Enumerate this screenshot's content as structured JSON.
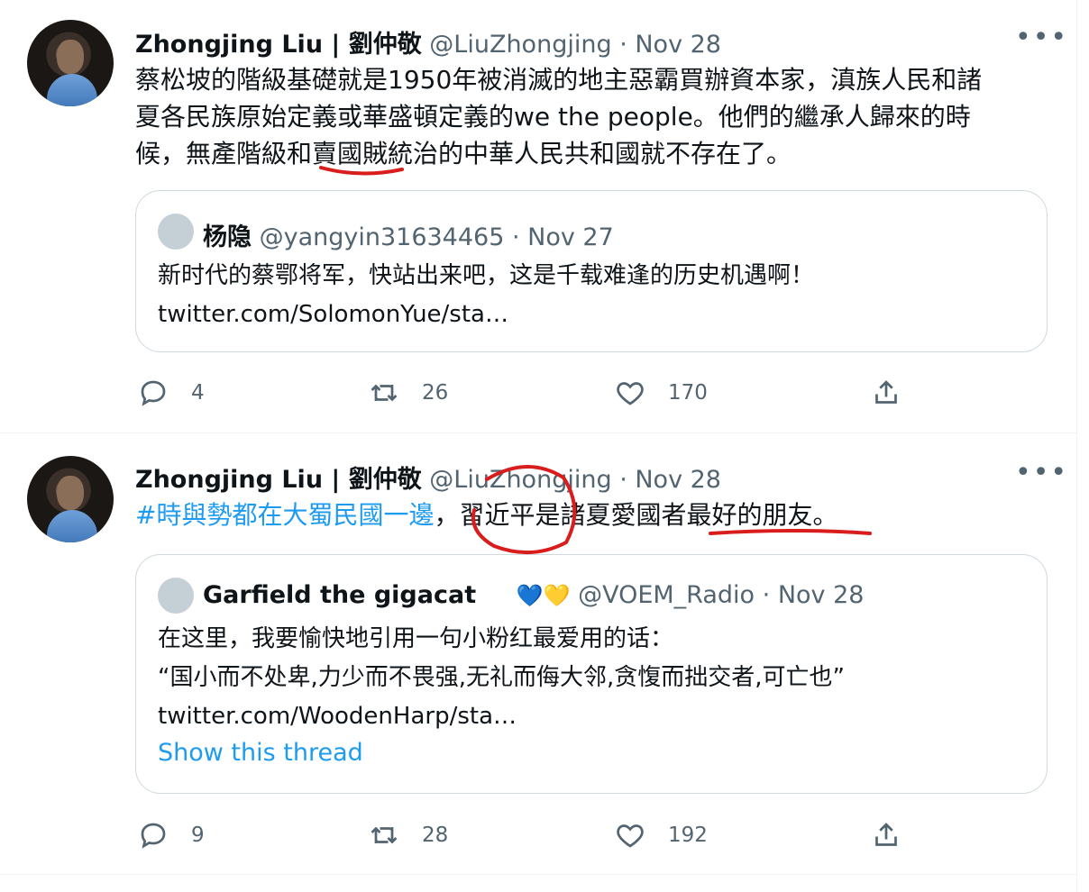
{
  "tweets": [
    {
      "author_name": "Zhongjing Liu | 劉仲敬",
      "handle": "@LiuZhongjing",
      "date": "· Nov 28",
      "more": "•••",
      "body_lines": [
        "蔡松坡的階級基礎就是1950年被消滅的地主惡霸買辦資本家，滇族人民和諸",
        "夏各民族原始定義或華盛頓定義的we the people。他們的繼承人歸來的時",
        "候，無產階級和賣國賊統治的中華人民共和國就不存在了。"
      ],
      "quote": {
        "author_name": "杨隐",
        "handle": "@yangyin31634465",
        "date": "· Nov 27",
        "lines": [
          "新时代的蔡鄂将军，快站出来吧，这是千载难逢的历史机遇啊！",
          "twitter.com/SolomonYue/sta…"
        ]
      },
      "stats": {
        "replies": "4",
        "retweets": "26",
        "likes": "170"
      }
    },
    {
      "author_name": "Zhongjing Liu | 劉仲敬",
      "handle": "@LiuZhongjing",
      "date": "· Nov 28",
      "more": "•••",
      "hashtag": "#時與勢都在大蜀民國一邊",
      "body_rest": "，習近平是諸夏愛國者最好的朋友。",
      "quote": {
        "author_name": "Garfield the gigacat",
        "handle": "@VOEM_Radio",
        "date": "· Nov 28",
        "heart_blue": "💙",
        "heart_yellow": "💛",
        "lines": [
          "在这里，我要愉快地引用一句小粉红最爱用的话：",
          "“国小而不处卑,力少而不畏强,无礼而侮大邻,贪愎而拙交者,可亡也”",
          "twitter.com/WoodenHarp/sta…"
        ],
        "show_thread": "Show this thread"
      },
      "stats": {
        "replies": "9",
        "retweets": "28",
        "likes": "192"
      }
    }
  ],
  "colors": {
    "accent": "#1d9bf0",
    "muted": "#536471",
    "border": "#cfd9de",
    "annotation": "#d91c1c"
  },
  "icons": [
    "reply-icon",
    "retweet-icon",
    "like-icon",
    "share-icon",
    "more-icon"
  ]
}
